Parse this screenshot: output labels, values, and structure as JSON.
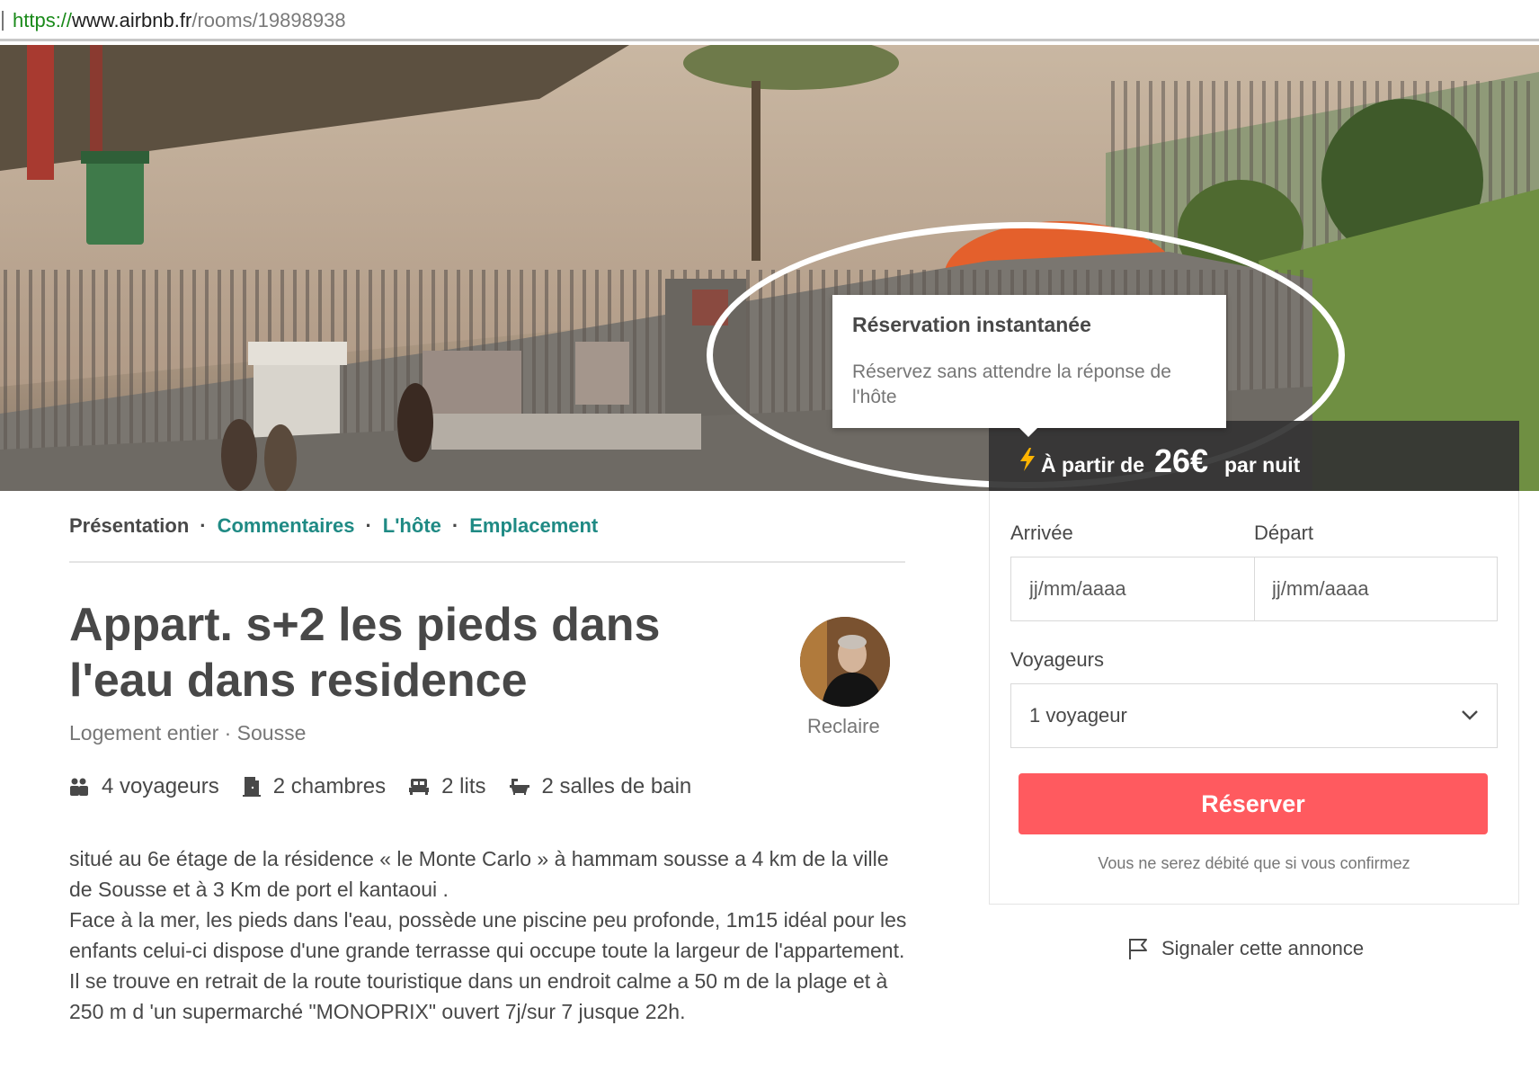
{
  "browser": {
    "url_scheme": "https://",
    "url_host": "www.airbnb.fr",
    "url_path": "/rooms/19898938"
  },
  "tooltip": {
    "title": "Réservation instantanée",
    "body": "Réservez sans attendre la réponse de l'hôte"
  },
  "price_bar": {
    "icon": "lightning-bolt-icon",
    "from_label": "À partir de",
    "price": "26€",
    "per_label": "par nuit"
  },
  "section_nav": {
    "items": [
      "Présentation",
      "Commentaires",
      "L'hôte",
      "Emplacement"
    ],
    "separator": "·"
  },
  "listing": {
    "title": "Appart. s+2 les pieds dans l'eau dans residence",
    "subtitle": "Logement entier · Sousse",
    "host_name": "Reclaire",
    "amenities": [
      {
        "icon": "guests-icon",
        "label": "4 voyageurs"
      },
      {
        "icon": "door-icon",
        "label": "2 chambres"
      },
      {
        "icon": "bed-icon",
        "label": "2 lits"
      },
      {
        "icon": "bathtub-icon",
        "label": "2 salles de bain"
      }
    ],
    "description": [
      "situé au 6e étage de la résidence « le Monte Carlo » à hammam sousse a 4 km de la ville de Sousse et à 3 Km de port el kantaoui .",
      "Face à la mer, les pieds dans l'eau, possède une piscine peu profonde, 1m15 idéal pour les enfants celui-ci dispose d'une grande terrasse qui occupe toute la largeur de l'appartement. Il se trouve en retrait de la route touristique dans un endroit calme a 50 m de la plage et à 250 m d 'un supermarché \"MONOPRIX\" ouvert 7j/sur 7 jusque 22h."
    ]
  },
  "booking": {
    "arrival_label": "Arrivée",
    "departure_label": "Départ",
    "arrival_placeholder": "jj/mm/aaaa",
    "departure_placeholder": "jj/mm/aaaa",
    "guests_label": "Voyageurs",
    "guests_value": "1 voyageur",
    "reserve_label": "Réserver",
    "note": "Vous ne serez débité que si vous confirmez",
    "report_label": "Signaler cette annonce"
  },
  "colors": {
    "accent": "#ff5a5f",
    "link": "#1f8a84",
    "text": "#484848",
    "muted": "#767676"
  }
}
